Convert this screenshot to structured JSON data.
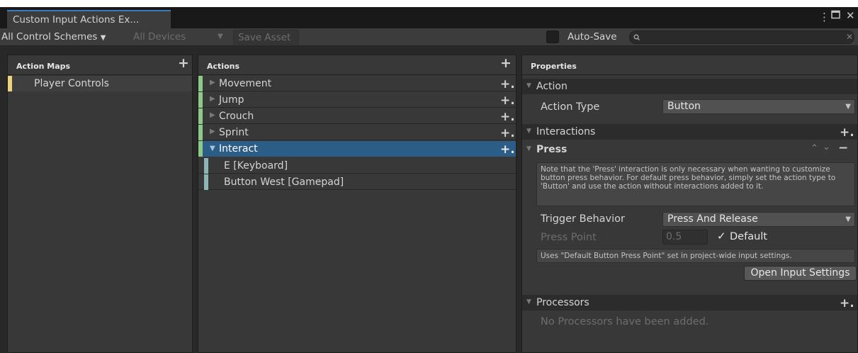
{
  "window": {
    "tab_title": "Custom Input Actions Ex...",
    "menu_icon": "kebab-menu-icon",
    "maximize_icon": "maximize-icon",
    "close_icon": "close-icon"
  },
  "toolbar": {
    "control_schemes": "All Control Schemes",
    "devices": "All Devices",
    "save_asset": "Save Asset",
    "auto_save_label": "Auto-Save",
    "auto_save_checked": false,
    "search_value": "",
    "search_icon": "search-icon"
  },
  "action_maps": {
    "title": "Action Maps",
    "items": [
      {
        "label": "Player Controls",
        "color": "#f0d27a",
        "selected": true
      }
    ]
  },
  "actions": {
    "title": "Actions",
    "items": [
      {
        "label": "Movement",
        "expanded": false,
        "selected": false
      },
      {
        "label": "Jump",
        "expanded": false,
        "selected": false
      },
      {
        "label": "Crouch",
        "expanded": false,
        "selected": false
      },
      {
        "label": "Sprint",
        "expanded": false,
        "selected": false
      },
      {
        "label": "Interact",
        "expanded": true,
        "selected": true
      }
    ],
    "bindings": [
      {
        "label": "E [Keyboard]"
      },
      {
        "label": "Button West [Gamepad]"
      }
    ],
    "action_color": "#8ec989",
    "binding_color": "#8db5b5",
    "selected_color": "#2c5d87"
  },
  "properties": {
    "title": "Properties",
    "action_section": "Action",
    "action_type_label": "Action Type",
    "action_type_value": "Button",
    "interactions_section": "Interactions",
    "press_section": "Press",
    "press_help": "Note that the 'Press' interaction is only necessary when wanting to customize button press behavior. For default press behavior, simply set the action type to 'Button' and use the action without interactions added to it.",
    "trigger_behavior_label": "Trigger Behavior",
    "trigger_behavior_value": "Press And Release",
    "press_point_label": "Press Point",
    "press_point_value": "0.5",
    "default_label": "Default",
    "default_checked": true,
    "press_point_help": "Uses \"Default Button Press Point\" set in project-wide input settings.",
    "open_settings_button": "Open Input Settings",
    "processors_section": "Processors",
    "no_processors": "No Processors have been added."
  }
}
